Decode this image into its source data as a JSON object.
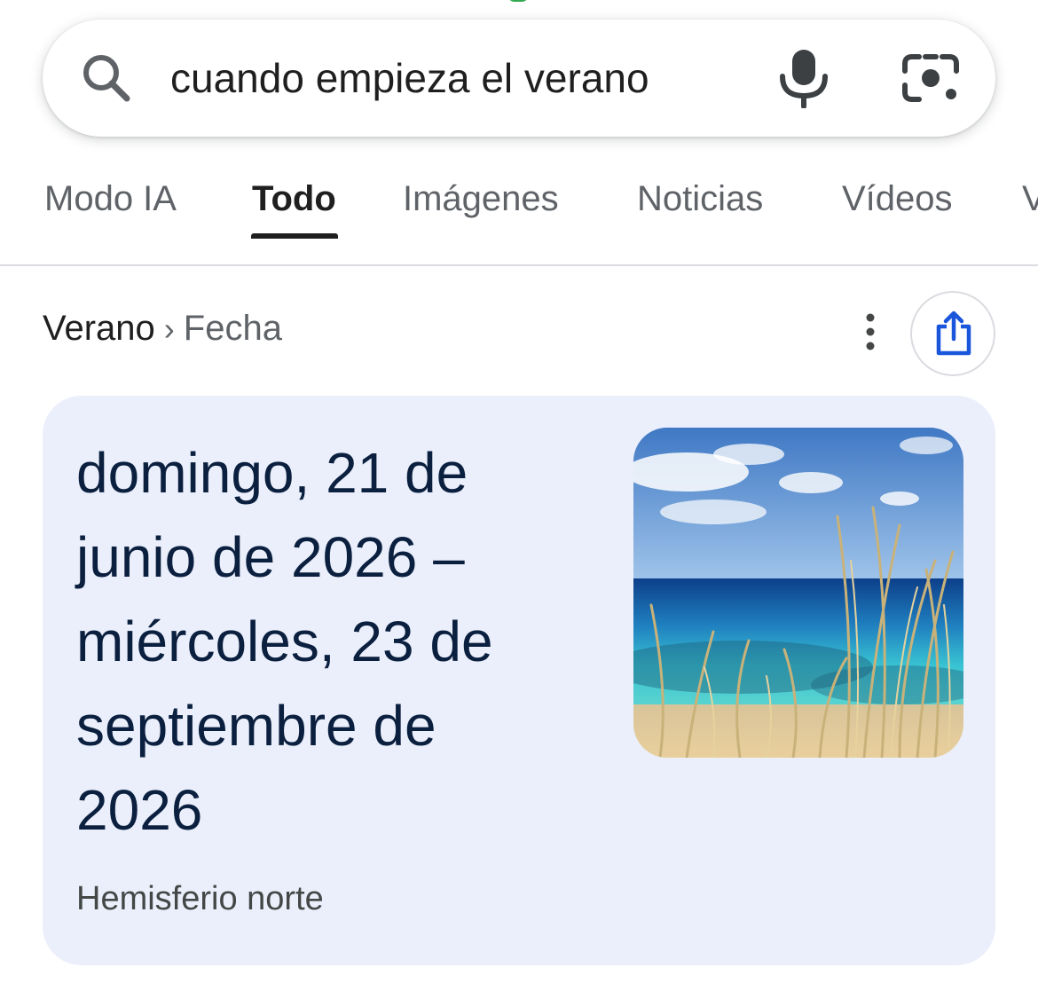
{
  "search": {
    "query": "cuando empieza el verano",
    "search_icon": "search-icon",
    "mic_icon": "mic-icon",
    "lens_icon": "camera-lens-icon"
  },
  "tabs": [
    {
      "label": "Modo IA",
      "active": false
    },
    {
      "label": "Todo",
      "active": true
    },
    {
      "label": "Imágenes",
      "active": false
    },
    {
      "label": "Noticias",
      "active": false
    },
    {
      "label": "Vídeos",
      "active": false
    },
    {
      "label": "V",
      "active": false
    }
  ],
  "breadcrumb": {
    "main": "Verano",
    "separator": "›",
    "sub": "Fecha",
    "more_icon": "more-vert-icon",
    "share_icon": "share-icon"
  },
  "answer": {
    "date_range": "domingo, 21 de junio de 2026 – miércoles, 23 de septiembre de 2026",
    "subtitle": "Hemisferio norte",
    "image": "beach-grass-photo"
  },
  "colors": {
    "card_background": "#eaeffb",
    "answer_text": "#0b1f3f",
    "share_icon": "#1a56db",
    "accent_green": "#34a853"
  }
}
